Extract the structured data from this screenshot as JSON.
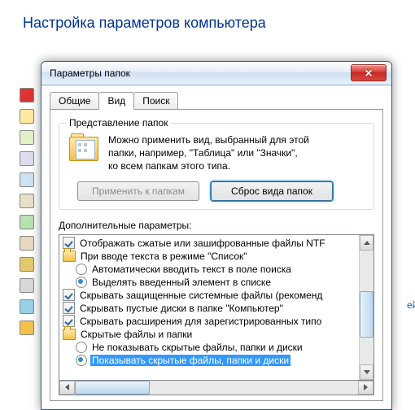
{
  "page_title": "Настройка параметров компьютера",
  "background_hint": "ей",
  "dialog": {
    "title": "Параметры папок",
    "tabs": {
      "general": "Общие",
      "view": "Вид",
      "search": "Поиск",
      "active_index": 1
    },
    "groupbox": {
      "legend": "Представление папок",
      "line1": "Можно применить вид, выбранный для этой",
      "line2": "папки, например, \"Таблица\" или \"Значки\",",
      "line3": "ко всем папкам этого типа.",
      "apply_btn": "Применить к папкам",
      "reset_btn": "Сброс вида папок"
    },
    "advanced_label": "Дополнительные параметры:",
    "tree": {
      "r0": {
        "kind": "checkbox",
        "checked": true,
        "indent": 0,
        "text": "Отображать сжатые или зашифрованные файлы NTF"
      },
      "r1": {
        "kind": "folder",
        "indent": 0,
        "text": "При вводе текста в режиме \"Список\""
      },
      "r2": {
        "kind": "radio",
        "checked": false,
        "indent": 1,
        "text": "Автоматически вводить текст в поле поиска"
      },
      "r3": {
        "kind": "radio",
        "checked": true,
        "indent": 1,
        "text": "Выделять введенный элемент в списке"
      },
      "r4": {
        "kind": "checkbox",
        "checked": true,
        "indent": 0,
        "text": "Скрывать защищенные системные файлы (рекоменд"
      },
      "r5": {
        "kind": "checkbox",
        "checked": true,
        "indent": 0,
        "text": "Скрывать пустые диски в папке \"Компьютер\""
      },
      "r6": {
        "kind": "checkbox",
        "checked": true,
        "indent": 0,
        "text": "Скрывать расширения для зарегистрированных типо"
      },
      "r7": {
        "kind": "folder",
        "indent": 0,
        "text": "Скрытые файлы и папки"
      },
      "r8": {
        "kind": "radio",
        "checked": false,
        "indent": 1,
        "text": "Не показывать скрытые файлы, папки и диски"
      },
      "r9": {
        "kind": "radio",
        "checked": true,
        "indent": 1,
        "text": "Показывать скрытые файлы, папки и диски",
        "highlight": true
      }
    }
  }
}
